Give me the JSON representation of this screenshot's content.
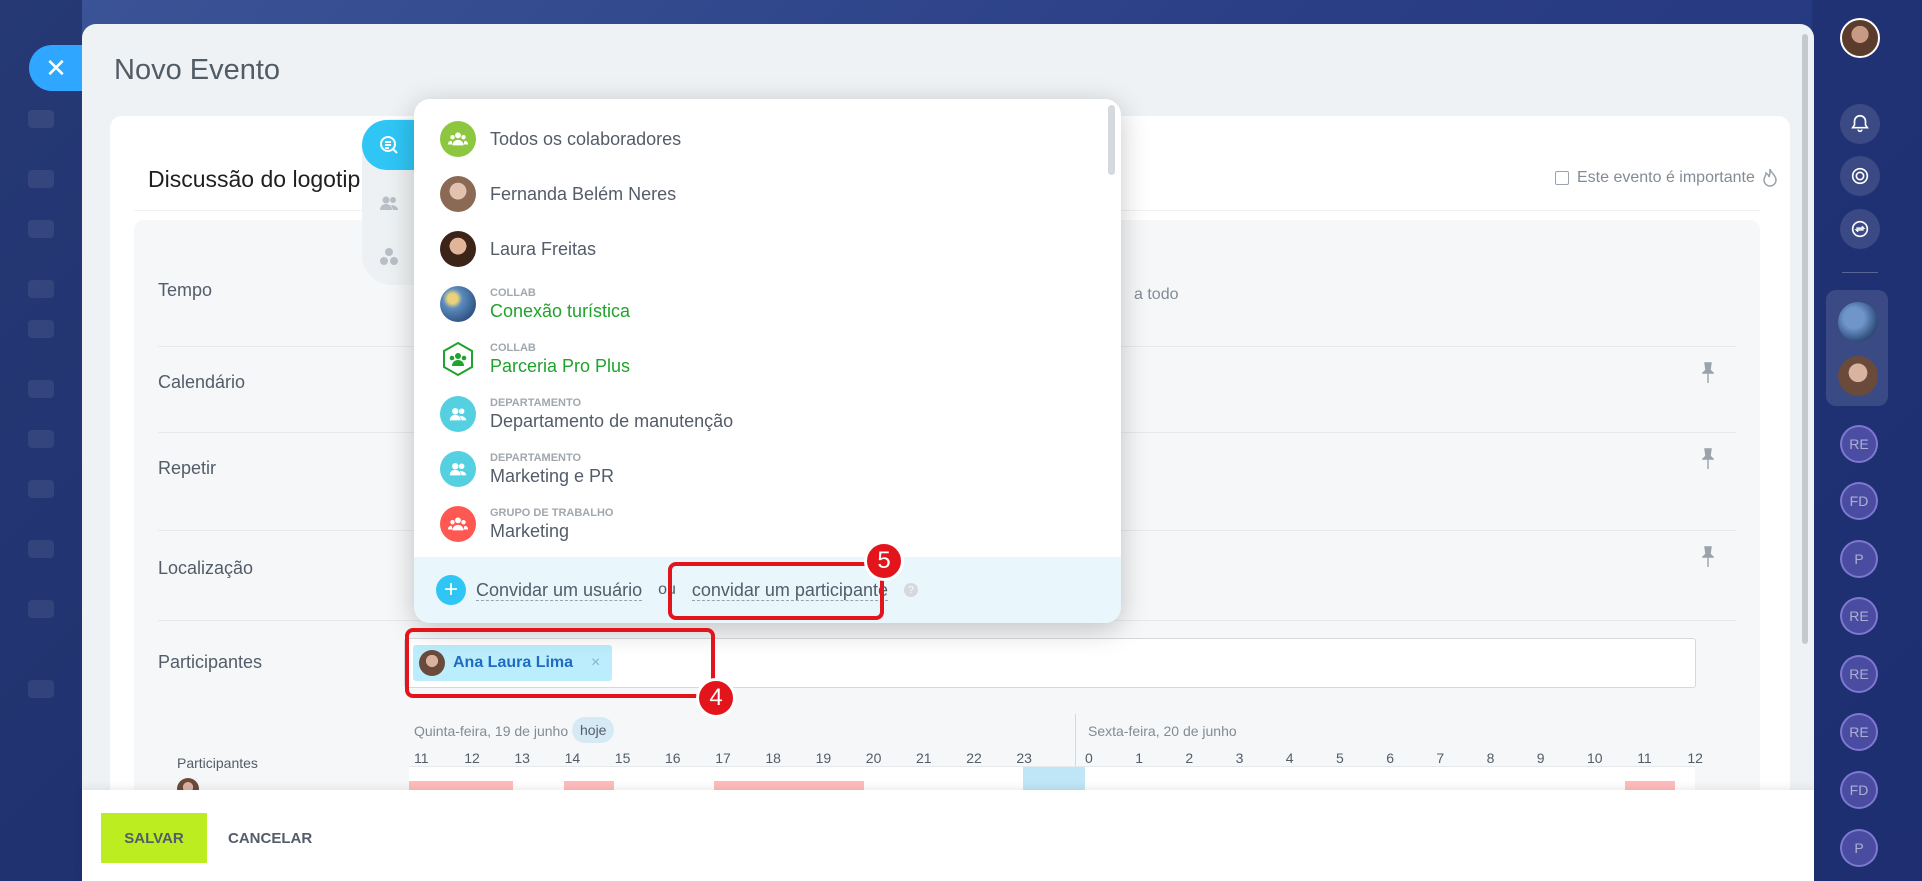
{
  "window": {
    "title": "Novo Evento",
    "close_icon": "close-icon"
  },
  "event": {
    "name": "Discussão do logotip",
    "importance_label": "Este evento é importante"
  },
  "form": {
    "rows": [
      {
        "label": "Tempo"
      },
      {
        "label": "Calendário"
      },
      {
        "label": "Repetir"
      },
      {
        "label": "Localização"
      },
      {
        "label": "Participantes"
      }
    ],
    "time_hint": "a todo"
  },
  "participants": {
    "chip_name": "Ana Laura Lima",
    "chip_remove": "×"
  },
  "timeline": {
    "participants_label": "Participantes",
    "day1": "Quinta-feira, 19 de junho",
    "today_badge": "hoje",
    "day2": "Sexta-feira, 20 de junho",
    "hours_day1": [
      "11",
      "12",
      "13",
      "14",
      "15",
      "16",
      "17",
      "18",
      "19",
      "20",
      "21",
      "22",
      "23"
    ],
    "hours_day2": [
      "0",
      "1",
      "2",
      "3",
      "4",
      "5",
      "6",
      "7",
      "8",
      "9",
      "10",
      "11",
      "12"
    ]
  },
  "selector": {
    "items": [
      {
        "kind": "",
        "name": "Todos os colaboradores",
        "icon": "all-employees-icon",
        "color": "#8dc63f"
      },
      {
        "kind": "",
        "name": "Fernanda Belém Neres",
        "icon": "user-avatar",
        "color": "#8a6a55"
      },
      {
        "kind": "",
        "name": "Laura Freitas",
        "icon": "user-avatar",
        "color": "#5b3a2a"
      },
      {
        "kind": "COLLAB",
        "name": "Conexão turística",
        "icon": "collab-image",
        "color": "#3a6aa0"
      },
      {
        "kind": "COLLAB",
        "name": "Parceria Pro Plus",
        "icon": "collab-icon",
        "color": "#1fa32c"
      },
      {
        "kind": "DEPARTAMENTO",
        "name": "Departamento de manutenção",
        "icon": "department-icon",
        "color": "#55d0e0"
      },
      {
        "kind": "DEPARTAMENTO",
        "name": "Marketing e PR",
        "icon": "department-icon",
        "color": "#55d0e0"
      },
      {
        "kind": "GRUPO DE TRABALHO",
        "name": "Marketing",
        "icon": "workgroup-icon",
        "color": "#ff5752"
      }
    ],
    "invite_user": "Convidar um usuário",
    "or": "ou",
    "invite_participant": "convidar um participante",
    "help": "?"
  },
  "annotations": {
    "step4": "4",
    "step5": "5"
  },
  "rail": {
    "initials": [
      "RE",
      "FD",
      "P",
      "RE",
      "RE",
      "RE",
      "FD",
      "P"
    ]
  },
  "footer": {
    "save": "SALVAR",
    "cancel": "CANCELAR"
  },
  "colors": {
    "accent": "#2fc6f6",
    "save": "#bbed21",
    "marker": "#e3141b",
    "collab": "#1fa32c"
  }
}
